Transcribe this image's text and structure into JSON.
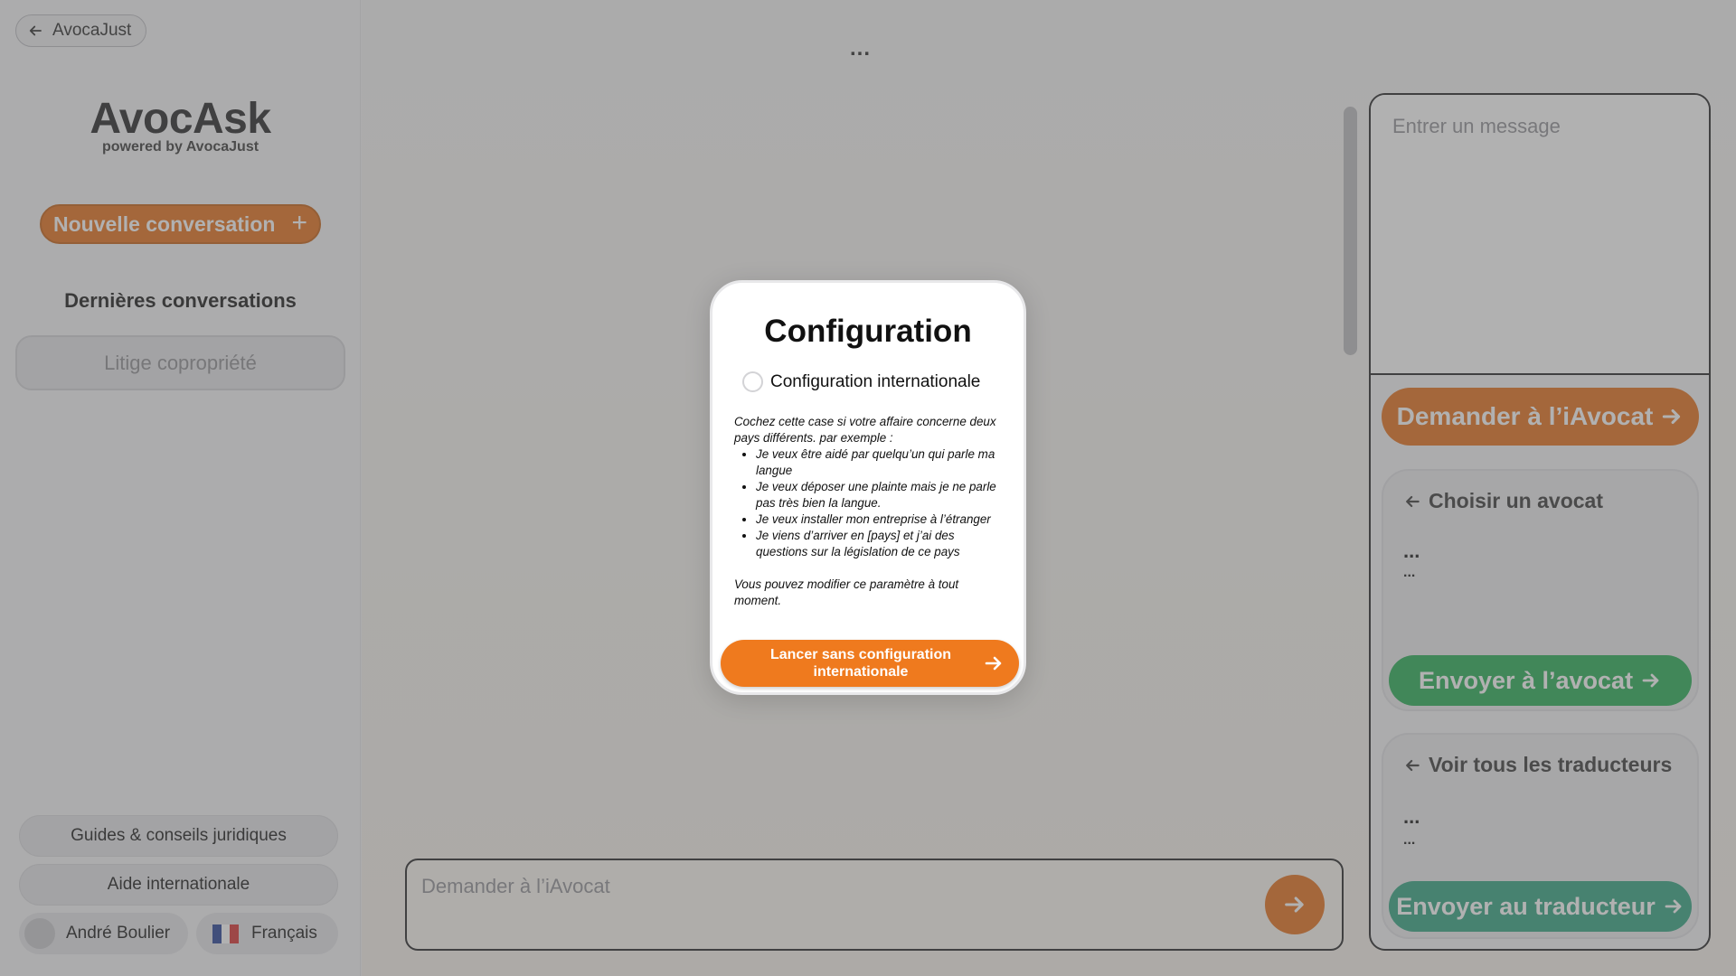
{
  "sidebar": {
    "back_label": "AvocaJust",
    "brand_name": "AvocAsk",
    "brand_sub": "powered by AvocaJust",
    "new_conversation": "Nouvelle conversation",
    "recent_title": "Dernières conversations",
    "conversations": [
      "Litige copropriété"
    ],
    "guides": "Guides & conseils juridiques",
    "international_help": "Aide internationale",
    "user_name": "André Boulier",
    "language": "Français"
  },
  "main": {
    "more_menu": "...",
    "ask_placeholder": "Demander à l’iAvocat"
  },
  "right_panel": {
    "message_placeholder": "Entrer un message",
    "ask_avocat": "Demander à l’iAvocat",
    "lawyer_card": {
      "title": "Choisir un avocat",
      "dots1": "...",
      "dots2": "...",
      "send": "Envoyer à l’avocat"
    },
    "translator_card": {
      "title": "Voir tous les traducteurs",
      "dots1": "...",
      "dots2": "...",
      "send": "Envoyer au traducteur"
    }
  },
  "modal": {
    "title": "Configuration",
    "checkbox_label": "Configuration internationale",
    "intro": "Cochez cette case si votre affaire concerne deux pays différents. par exemple :",
    "examples": [
      "Je veux être aidé par quelqu’un qui parle ma langue",
      "Je veux déposer une plainte mais je ne parle pas très bien la langue.",
      "Je veux installer mon entreprise à l’étranger",
      "Je viens d’arriver en [pays] et j’ai des questions sur la législation de ce pays"
    ],
    "note": "Vous pouvez modifier ce paramètre à tout moment.",
    "launch_button": "Lancer sans configuration internationale"
  },
  "colors": {
    "accent_orange": "#e46a12",
    "green": "#1eaa4e",
    "teal": "#2aa17c"
  }
}
